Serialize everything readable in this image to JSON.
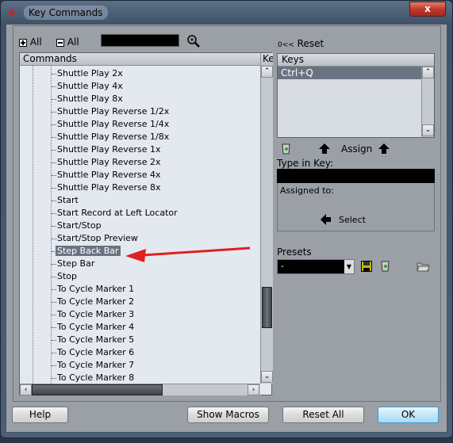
{
  "window": {
    "title": "Key Commands",
    "close_label": "x"
  },
  "toolbar": {
    "expand_all": "All",
    "collapse_all": "All",
    "search_value": "",
    "reset": "Reset",
    "reset_prefix": "0<<"
  },
  "list": {
    "header_commands": "Commands",
    "header_keys": "Key",
    "items": [
      "Shuttle Play 2x",
      "Shuttle Play 4x",
      "Shuttle Play 8x",
      "Shuttle Play Reverse 1/2x",
      "Shuttle Play Reverse 1/4x",
      "Shuttle Play Reverse 1/8x",
      "Shuttle Play Reverse 1x",
      "Shuttle Play Reverse 2x",
      "Shuttle Play Reverse 4x",
      "Shuttle Play Reverse 8x",
      "Start",
      "Start Record at Left Locator",
      "Start/Stop",
      "Start/Stop Preview",
      "Step Back Bar",
      "Step Bar",
      "Stop",
      "To Cycle Marker 1",
      "To Cycle Marker 2",
      "To Cycle Marker 3",
      "To Cycle Marker 4",
      "To Cycle Marker 5",
      "To Cycle Marker 6",
      "To Cycle Marker 7",
      "To Cycle Marker 8"
    ],
    "selected": "Step Back Bar"
  },
  "keys": {
    "header": "Keys",
    "items": [
      "Ctrl+Q"
    ]
  },
  "assign": {
    "label": "Assign",
    "type_in_key": "Type in Key:",
    "type_value": "",
    "assigned_to": "Assigned to:",
    "select": "Select"
  },
  "presets": {
    "label": "Presets",
    "value": "-"
  },
  "buttons": {
    "help": "Help",
    "show_macros": "Show Macros",
    "reset_all": "Reset All",
    "ok": "OK"
  },
  "colors": {
    "annotation_arrow": "#e02020",
    "selection": "#6a7380"
  }
}
